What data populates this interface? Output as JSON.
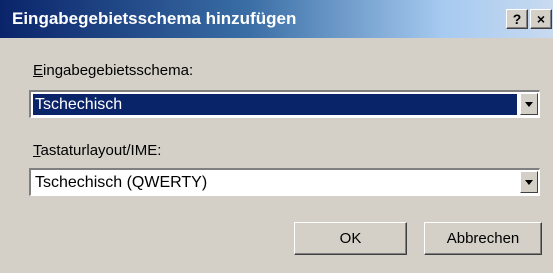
{
  "window": {
    "title": "Eingabegebietsschema hinzufügen",
    "help_label": "?",
    "close_label": "×"
  },
  "locale": {
    "label_first": "E",
    "label_rest": "ingabegebietsschema:",
    "value": "Tschechisch"
  },
  "layout": {
    "label_first": "T",
    "label_rest": "astaturlayout/IME:",
    "value": "Tschechisch (QWERTY)"
  },
  "buttons": {
    "ok": "OK",
    "cancel": "Abbrechen"
  }
}
